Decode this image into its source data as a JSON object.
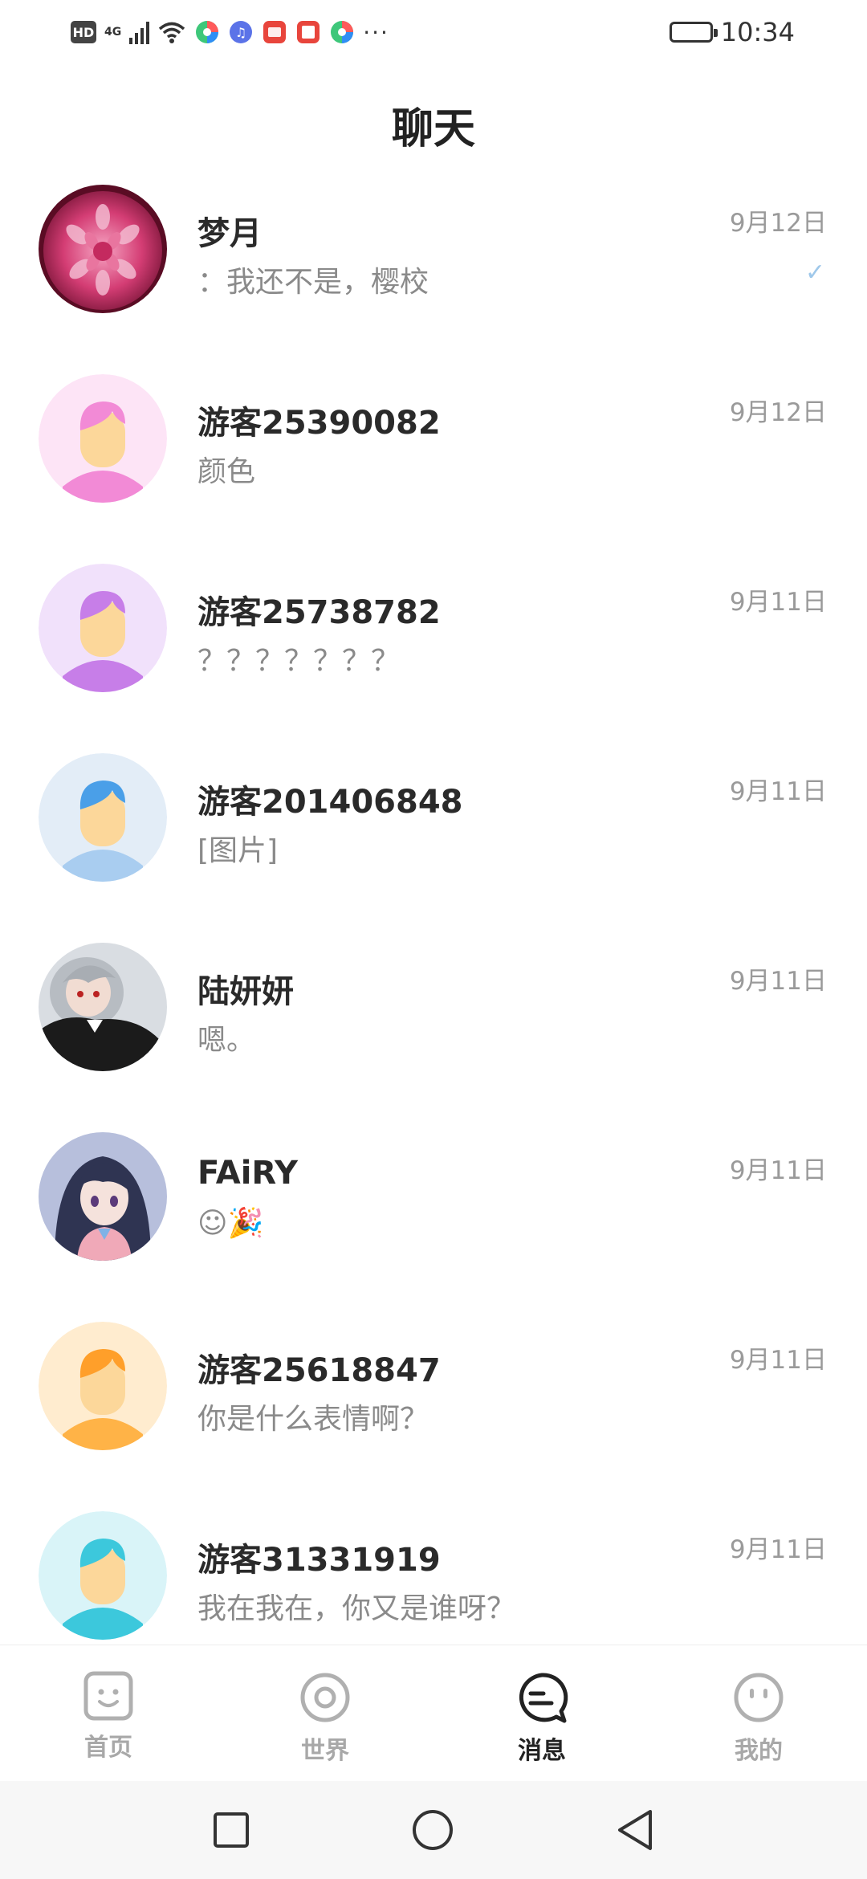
{
  "status_bar": {
    "hd": "HD",
    "network": "4G",
    "dots": "···",
    "time": "10:34"
  },
  "header": {
    "title": "聊天"
  },
  "chats": [
    {
      "name": "梦月",
      "preview": "：我还不是，樱校",
      "date": "9月12日",
      "read": true
    },
    {
      "name": "游客25390082",
      "preview": "颜色",
      "date": "9月12日"
    },
    {
      "name": "游客25738782",
      "preview": "？？？？？？？",
      "date": "9月11日"
    },
    {
      "name": "游客201406848",
      "preview": "[图片]",
      "date": "9月11日"
    },
    {
      "name": "陆妍妍",
      "preview": "嗯。",
      "date": "9月11日"
    },
    {
      "name": "FAiRY",
      "preview": "☺🎉",
      "date": "9月11日"
    },
    {
      "name": "游客25618847",
      "preview": "你是什么表情啊？",
      "date": "9月11日"
    },
    {
      "name": "游客31331919",
      "preview": "我在我在，你又是谁呀？",
      "date": "9月11日"
    }
  ],
  "colors": {
    "pink_guest": "#f28ad6",
    "purple_guest": "#c77ee8",
    "blue_guest": "#4a9fe8",
    "orange_guest": "#ff9f2a",
    "cyan_guest": "#3cc8dc",
    "skin": "#fcd79a"
  },
  "bottom_nav": {
    "tabs": [
      {
        "label": "首页",
        "icon": "home-face-icon"
      },
      {
        "label": "世界",
        "icon": "world-ring-icon"
      },
      {
        "label": "消息",
        "icon": "message-bubble-icon",
        "active": true
      },
      {
        "label": "我的",
        "icon": "profile-face-icon"
      }
    ]
  }
}
